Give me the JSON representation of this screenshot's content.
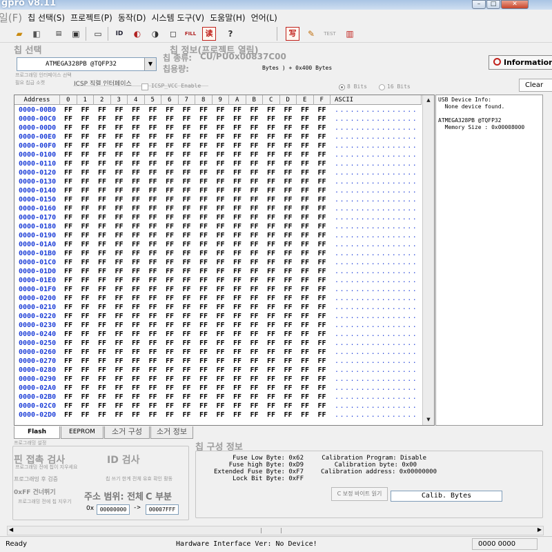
{
  "title_bar": {
    "app_title": "gpro v8.11",
    "minimize": "–",
    "maximize": "□",
    "close": "✕"
  },
  "menu": {
    "items": [
      "일(F)",
      "칩 선택(S)",
      "프로젝트(P)",
      "동작(D)",
      "시스템 도구(V)",
      "도움말(H)",
      "언어(L)"
    ]
  },
  "toolbar": {
    "id_label": "ID",
    "fill_label": "FILL",
    "read_label": "读",
    "help_label": "?",
    "write_label": "写",
    "test_label": "TEST"
  },
  "chip_select": {
    "group_label": "칩 선택",
    "selected": "ATMEGA328PB @TQFP32",
    "hint_line1": "프로그래밍 인터페이스 선택",
    "hint_line2": "필요 칩급 소켓",
    "icsp_label": "ICSP 직렬 인터페이스",
    "icsp_vcc": "ICSP_VCC Enable"
  },
  "chip_info": {
    "group_label": "칩 정보(프로젝트 열림)",
    "chip_type_label": "칩 종류:",
    "chip_type_value": "CU/PU0x00837C00",
    "capacity_label": "칩용량:",
    "capacity_value": "Bytes ) + 0x400 Bytes",
    "bits8": "8 Bits",
    "bits16": "16 Bits"
  },
  "buttons": {
    "information": "Information",
    "clear": "Clear"
  },
  "hex": {
    "address_header": "Address",
    "columns": [
      "0",
      "1",
      "2",
      "3",
      "4",
      "5",
      "6",
      "7",
      "8",
      "9",
      "A",
      "B",
      "C",
      "D",
      "E",
      "F"
    ],
    "ascii_header": "ASCII",
    "fill_value": "FF",
    "ascii_value": "................",
    "addresses": [
      "0000-00B0",
      "0000-00C0",
      "0000-00D0",
      "0000-00E0",
      "0000-00F0",
      "0000-0100",
      "0000-0110",
      "0000-0120",
      "0000-0130",
      "0000-0140",
      "0000-0150",
      "0000-0160",
      "0000-0170",
      "0000-0180",
      "0000-0190",
      "0000-01A0",
      "0000-01B0",
      "0000-01C0",
      "0000-01D0",
      "0000-01E0",
      "0000-01F0",
      "0000-0200",
      "0000-0210",
      "0000-0220",
      "0000-0230",
      "0000-0240",
      "0000-0250",
      "0000-0260",
      "0000-0270",
      "0000-0280",
      "0000-0290",
      "0000-02A0",
      "0000-02B0",
      "0000-02C0",
      "0000-02D0"
    ]
  },
  "info_panel": {
    "lines": "USB Device Info:\n  None device found.\n\nATMEGA328PB @TQFP32\n  Memory Size : 0x00008000"
  },
  "tabs": {
    "flash": "Flash",
    "eeprom": "EEPROM",
    "config": "소거 구성",
    "info": "소거 정보"
  },
  "prog_options": {
    "setting_label": "프로그래밍 설정",
    "pin_check": "핀 접촉 검사",
    "id_check": "ID 검사",
    "pin_check_hint": "프로그래밍 전에 칩이 지우세요",
    "verify_after": "프로그래밍 후 검증",
    "verify_hint": "칩 쓰기 한계 전체 유효 확인 활동",
    "skip_ff": "0xFF 건너뛰기",
    "erase_hint": "프로그래밍 전에 칩 지우기",
    "addr_range": "주소 범위: 전체",
    "c_part": "C 부분",
    "prefix": "0x",
    "start_addr": "00000000",
    "arrow": "->",
    "end_addr": "00007FFF"
  },
  "chip_config": {
    "group_label": "칩 구성 정보",
    "fuse_low": "Fuse Low Byte: 0x62",
    "fuse_high": "Fuse high Byte: 0xD9",
    "fuse_ext": "Extended Fuse Byte: 0xF7",
    "lock_bit": "Lock Bit Byte: 0xFF",
    "calib_prog": "Calibration Program: Disable",
    "calib_byte": "Calibration byte: 0x00",
    "calib_addr": "Calibration address: 0x00000000",
    "read_calib_button": "C 보정 바이트 읽기",
    "calib_bytes": "Calib. Bytes"
  },
  "status": {
    "left": "Ready",
    "center": "Hardware Interface Ver: No Device!",
    "right": "0000 0000"
  },
  "colors": {
    "address_blue": "#1e3fd8",
    "accent_red": "#c0201a"
  }
}
